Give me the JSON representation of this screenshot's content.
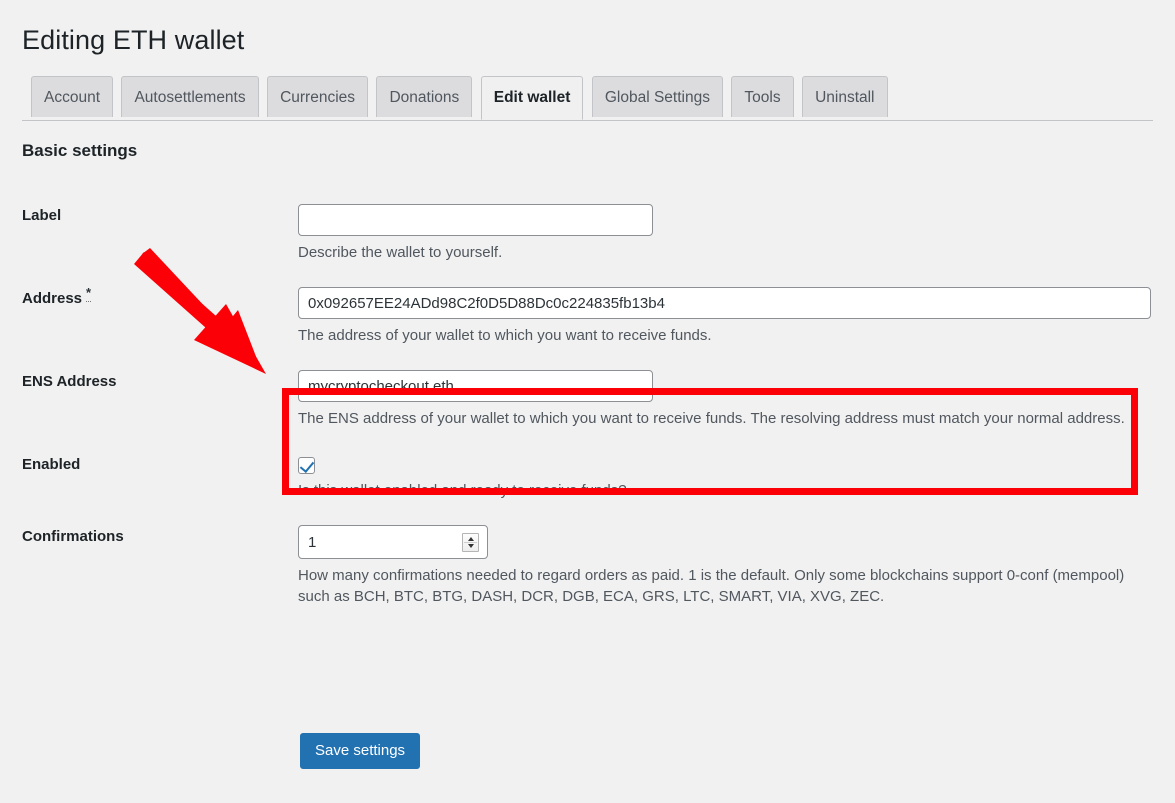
{
  "header": {
    "title": "Editing ETH wallet"
  },
  "tabs": [
    {
      "label": "Account",
      "active": false
    },
    {
      "label": "Autosettlements",
      "active": false
    },
    {
      "label": "Currencies",
      "active": false
    },
    {
      "label": "Donations",
      "active": false
    },
    {
      "label": "Edit wallet",
      "active": true
    },
    {
      "label": "Global Settings",
      "active": false
    },
    {
      "label": "Tools",
      "active": false
    },
    {
      "label": "Uninstall",
      "active": false
    }
  ],
  "section": {
    "heading": "Basic settings"
  },
  "fields": {
    "label": {
      "title": "Label",
      "value": "",
      "placeholder": "",
      "description": "Describe the wallet to yourself."
    },
    "address": {
      "title": "Address",
      "required_marker": "*",
      "value": "0x092657EE24ADd98C2f0D5D88Dc0c224835fb13b4",
      "description": "The address of your wallet to which you want to receive funds."
    },
    "ens_address": {
      "title": "ENS Address",
      "value": "mycryptocheckout.eth",
      "description": "The ENS address of your wallet to which you want to receive funds. The resolving address must match your normal address."
    },
    "enabled": {
      "title": "Enabled",
      "checked": true,
      "description": "Is this wallet enabled and ready to receive funds?"
    },
    "confirmations": {
      "title": "Confirmations",
      "value": "1",
      "description": "How many confirmations needed to regard orders as paid. 1 is the default. Only some blockchains support 0-conf (mempool) such as BCH, BTC, BTG, DASH, DCR, DGB, ECA, GRS, LTC, SMART, VIA, XVG, ZEC."
    }
  },
  "actions": {
    "save_label": "Save settings"
  },
  "annotations": {
    "highlight_color": "#fb0007",
    "arrow_color": "#fb0007"
  },
  "colors": {
    "page_background": "#f1f1f1",
    "primary_button": "#2271b1",
    "checkbox_accent": "#2271b1"
  }
}
